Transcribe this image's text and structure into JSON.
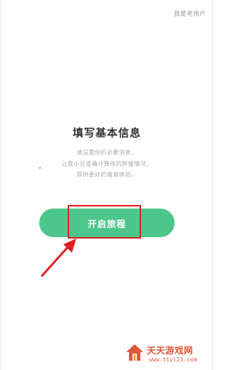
{
  "header": {
    "old_user_link": "我是老用户"
  },
  "main": {
    "title": "填写基本信息",
    "desc_lines": [
      "请设置你的必要消息，",
      "让我小豆准确计算你的胖瘦情况，",
      "提供更好的瘦身体验。"
    ],
    "start_button_label": "开启旅程"
  },
  "watermark": {
    "title": "天天游戏网",
    "url": "www.ttyl23.com"
  },
  "colors": {
    "accent": "#4cc68b",
    "highlight": "#e02020",
    "watermark": "#e2563a"
  }
}
